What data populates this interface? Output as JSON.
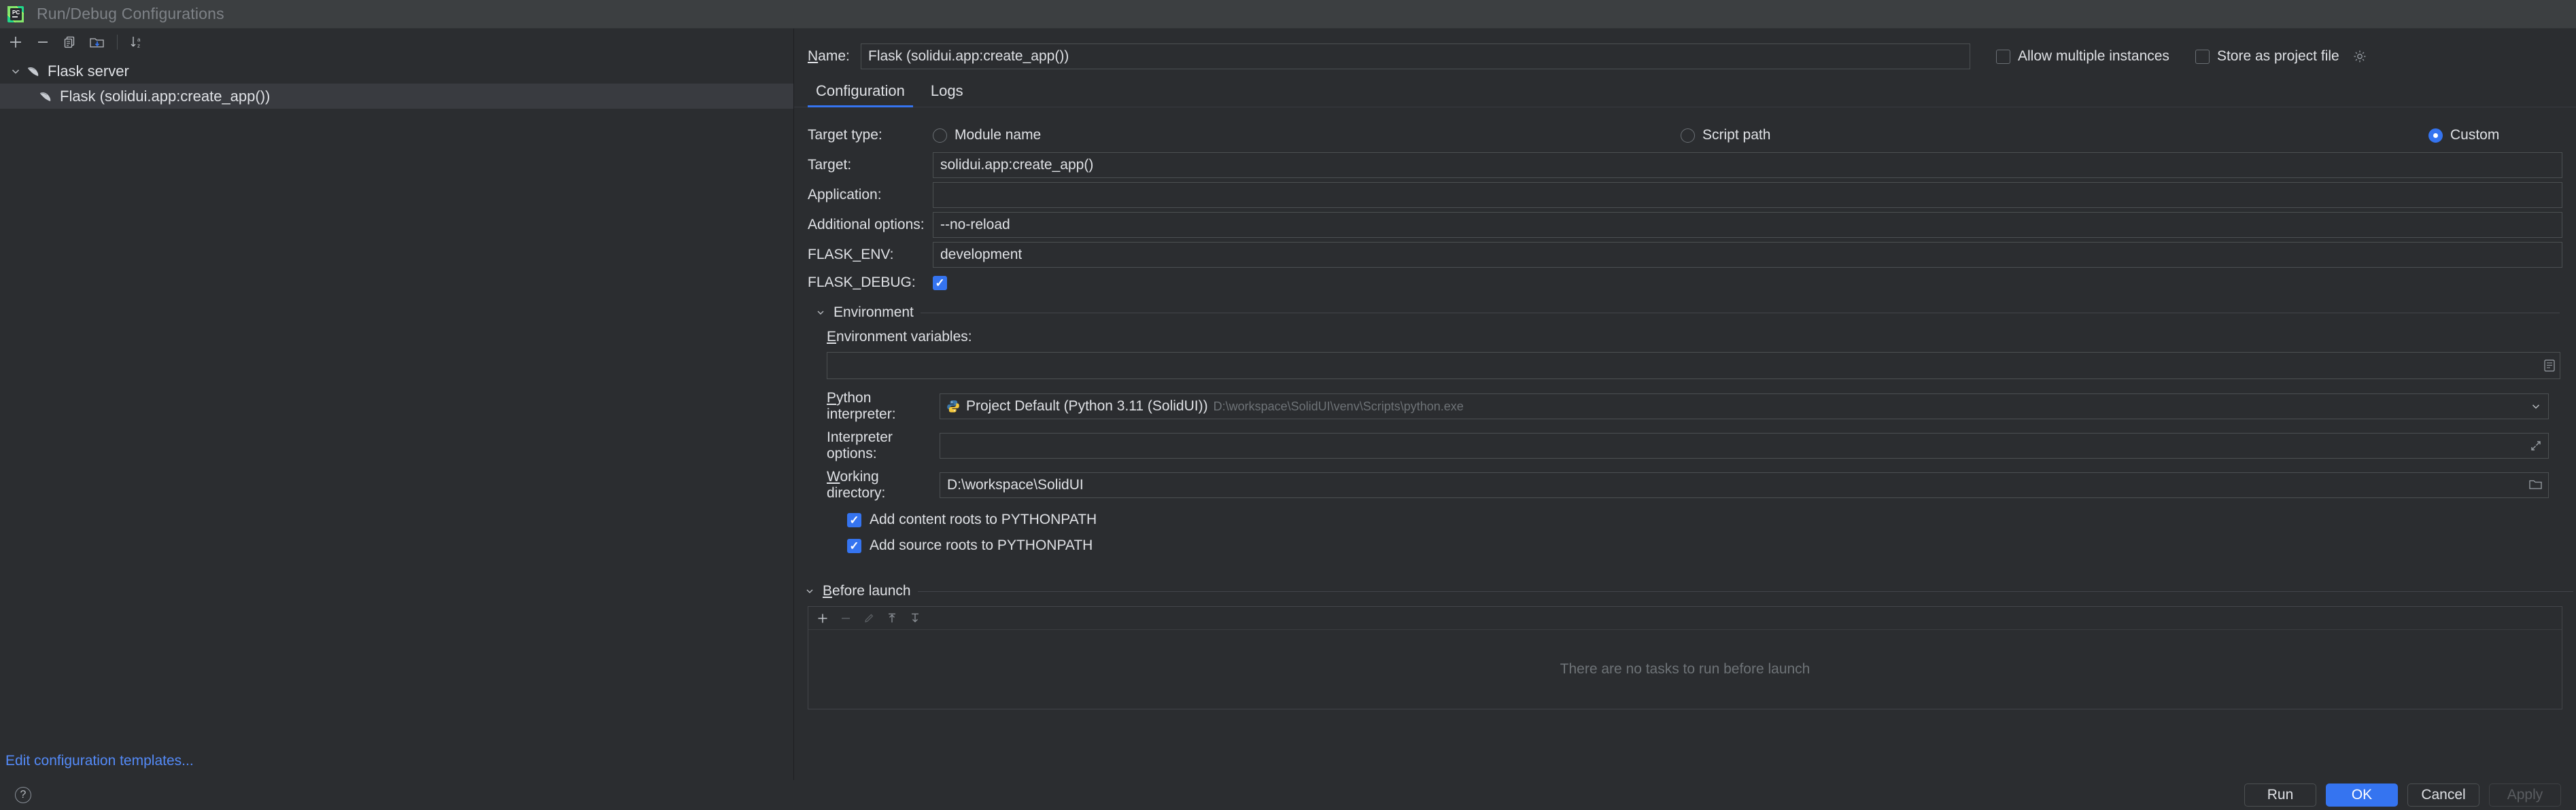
{
  "window": {
    "title": "Run/Debug Configurations",
    "logo_icon": "pycharm-logo-icon"
  },
  "sidebar": {
    "toolbar": [
      {
        "name": "add-configuration-button",
        "icon": "plus-icon",
        "label": "Add New Configuration"
      },
      {
        "name": "remove-configuration-button",
        "icon": "minus-icon",
        "label": "Remove Configuration"
      },
      {
        "name": "copy-configuration-button",
        "icon": "copy-icon",
        "label": "Copy Configuration"
      },
      {
        "name": "move-into-folder-button",
        "icon": "folder-add-icon",
        "label": "Move into new folder / Create new folder"
      },
      {
        "name": "sort-configurations-button",
        "icon": "sort-alphabetically-icon",
        "label": "Sort Configurations"
      }
    ],
    "tree": [
      {
        "label": "Flask server",
        "icon": "flask-icon",
        "expanded": true,
        "is_group": true,
        "selected": false
      },
      {
        "label": "Flask (solidui.app:create_app())",
        "icon": "flask-icon",
        "expanded": false,
        "is_group": false,
        "selected": true
      }
    ],
    "edit_templates_link": "Edit configuration templates..."
  },
  "name_row": {
    "label": "Name:",
    "label_mnemonic": "N",
    "label_rest": "ame:",
    "value": "Flask (solidui.app:create_app())",
    "placeholder": "",
    "allow_multiple_instances": {
      "label": "Allow multiple instances",
      "checked": false
    },
    "store_as_project_file": {
      "label": "Store as project file",
      "checked": false,
      "gear_icon": "gear-icon"
    }
  },
  "tabs": [
    {
      "label": "Configuration",
      "active": true
    },
    {
      "label": "Logs",
      "active": false
    }
  ],
  "configuration": {
    "target_type": {
      "label": "Target type:",
      "options": [
        {
          "label": "Module name",
          "selected": false
        },
        {
          "label": "Script path",
          "selected": false
        },
        {
          "label": "Custom",
          "selected": true
        }
      ]
    },
    "target": {
      "label": "Target:",
      "value": "solidui.app:create_app()"
    },
    "application": {
      "label": "Application:",
      "value": ""
    },
    "additional_options": {
      "label": "Additional options:",
      "value": "--no-reload"
    },
    "flask_env": {
      "label": "FLASK_ENV:",
      "value": "development"
    },
    "flask_debug": {
      "label": "FLASK_DEBUG:",
      "checked": true
    },
    "environment_section": {
      "title": "Environment",
      "expanded": true,
      "env_vars": {
        "label": "Environment variables:",
        "label_mnemonic": "E",
        "label_rest": "nvironment variables:",
        "value": "",
        "browse_icon": "browse-variables-icon"
      },
      "python_interpreter": {
        "label": "Python interpreter:",
        "label_mnemonic": "P",
        "label_rest": "ython interpreter:",
        "icon": "python-icon",
        "value": "Project Default (Python 3.11 (SolidUI))",
        "path_hint": "D:\\workspace\\SolidUI\\venv\\Scripts\\python.exe",
        "arrow_icon": "chevron-down-icon"
      },
      "interpreter_options": {
        "label": "Interpreter options:",
        "value": "",
        "expand_icon": "expand-editor-icon"
      },
      "working_directory": {
        "label": "Working directory:",
        "label_mnemonic": "W",
        "label_rest": "orking directory:",
        "value": "D:\\workspace\\SolidUI",
        "browse_icon": "folder-icon"
      },
      "add_content_roots": {
        "label": "Add content roots to PYTHONPATH",
        "checked": true
      },
      "add_source_roots": {
        "label": "Add source roots to PYTHONPATH",
        "checked": true
      }
    },
    "before_launch": {
      "title": "Before launch",
      "title_mnemonic": "B",
      "title_rest": "efore launch",
      "expanded": true,
      "toolbar": [
        {
          "name": "before-launch-add-button",
          "icon": "plus-icon",
          "enabled": true
        },
        {
          "name": "before-launch-remove-button",
          "icon": "minus-icon",
          "enabled": false
        },
        {
          "name": "before-launch-edit-button",
          "icon": "pencil-icon",
          "enabled": false
        },
        {
          "name": "before-launch-move-up-button",
          "icon": "arrow-up-icon",
          "enabled": true
        },
        {
          "name": "before-launch-move-down-button",
          "icon": "arrow-down-icon",
          "enabled": true
        }
      ],
      "empty_text": "There are no tasks to run before launch"
    }
  },
  "footer": {
    "help_icon": "question-mark-icon",
    "buttons": [
      {
        "label": "Run",
        "style": "default",
        "enabled": true
      },
      {
        "label": "OK",
        "style": "primary",
        "enabled": true
      },
      {
        "label": "Cancel",
        "style": "default",
        "enabled": true
      },
      {
        "label": "Apply",
        "style": "disabled",
        "enabled": false
      }
    ]
  },
  "colors": {
    "accent": "#3574f0",
    "link": "#548af7",
    "background": "#2b2d30",
    "titlebar": "#3c3f41",
    "selection": "#393b40",
    "muted_text": "#6e7377"
  }
}
